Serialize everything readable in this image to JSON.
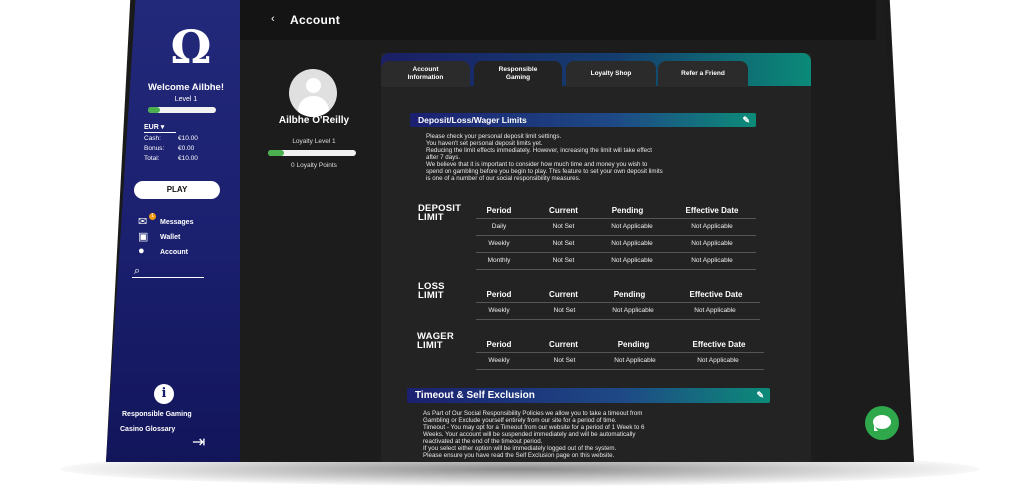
{
  "header": {
    "back_glyph": "‹",
    "title": "Account"
  },
  "sidebar": {
    "logo": "Ω",
    "welcome": "Welcome Ailbhe!",
    "level": "Level 1",
    "currency": "EUR ▾",
    "balances": [
      {
        "label": "Cash:",
        "value": "€10.00"
      },
      {
        "label": "Bonus:",
        "value": "€0.00"
      },
      {
        "label": "Total:",
        "value": "€10.00"
      }
    ],
    "play_label": "PLAY",
    "nav": [
      {
        "label": "Messages",
        "icon": "envelope-icon",
        "glyph": "✉",
        "badge": "1"
      },
      {
        "label": "Wallet",
        "icon": "wallet-icon",
        "glyph": "▣"
      },
      {
        "label": "Account",
        "icon": "user-icon",
        "glyph": "●"
      }
    ],
    "search_icon": "⌕",
    "info_glyph": "i",
    "responsible_gaming": "Responsible Gaming",
    "casino_glossary": "Casino Glossary",
    "logout_glyph": "⇥"
  },
  "profile": {
    "name": "Ailbhe O'Reilly",
    "loyalty_level": "Loyalty Level 1",
    "loyalty_points": "0 Loyalty Points"
  },
  "tabs": [
    {
      "label": "Account Information"
    },
    {
      "label": "Responsible Gaming",
      "active": true
    },
    {
      "label": "Loyalty Shop"
    },
    {
      "label": "Refer a Friend"
    }
  ],
  "deposit_section": {
    "title": "Deposit/Loss/Wager Limits",
    "text": [
      "Please check your personal deposit limit settings.",
      "You haven't set personal deposit limits yet.",
      "Reducing the limit effects immediately. However, increasing the limit will take effect",
      "after 7 days.",
      "We believe that it is important to consider how much time and money you wish to",
      "spend on gambling before you begin to play. This feature to set your own deposit limits",
      "is one of a number of our social responsibility measures."
    ]
  },
  "columns": [
    "Period",
    "Current",
    "Pending",
    "Effective Date"
  ],
  "limits": [
    {
      "title": [
        "DEPOSIT",
        "LIMIT"
      ],
      "rows": [
        [
          "Daily",
          "Not Set",
          "Not Applicable",
          "Not Applicable"
        ],
        [
          "Weekly",
          "Not Set",
          "Not Applicable",
          "Not Applicable"
        ],
        [
          "Monthly",
          "Not Set",
          "Not Applicable",
          "Not Applicable"
        ]
      ]
    },
    {
      "title": [
        "LOSS",
        "LIMIT"
      ],
      "rows": [
        [
          "Weekly",
          "Not Set",
          "Not Applicable",
          "Not Applicable"
        ]
      ]
    },
    {
      "title": [
        "WAGER",
        "LIMIT"
      ],
      "rows": [
        [
          "Weekly",
          "Not Set",
          "Not Applicable",
          "Not Applicable"
        ]
      ]
    }
  ],
  "timeout_section": {
    "title": "Timeout & Self Exclusion",
    "text": [
      "As Part of Our Social Responsibility Policies we allow you to take a timeout from",
      "Gambling or Exclude yourself entirely from our site for a period of time.",
      "Timeout - You may opt for a Timeout from our website for a period of 1 Week to 6",
      "Weeks. Your account will be suspended immediately and will be automatically",
      "reactivated at the end of the timeout period.",
      "If you select either option will be immediately logged out of the system.",
      "Please ensure you have read the Self Exclusion page on this website."
    ]
  },
  "pencil_glyph": "✎",
  "chat_icon": "chat-bubble-icon",
  "colors": {
    "accent_green": "#2ea84a",
    "sidebar_blue": "#1a1f6e",
    "header_gradient_end": "#0c8b78"
  }
}
